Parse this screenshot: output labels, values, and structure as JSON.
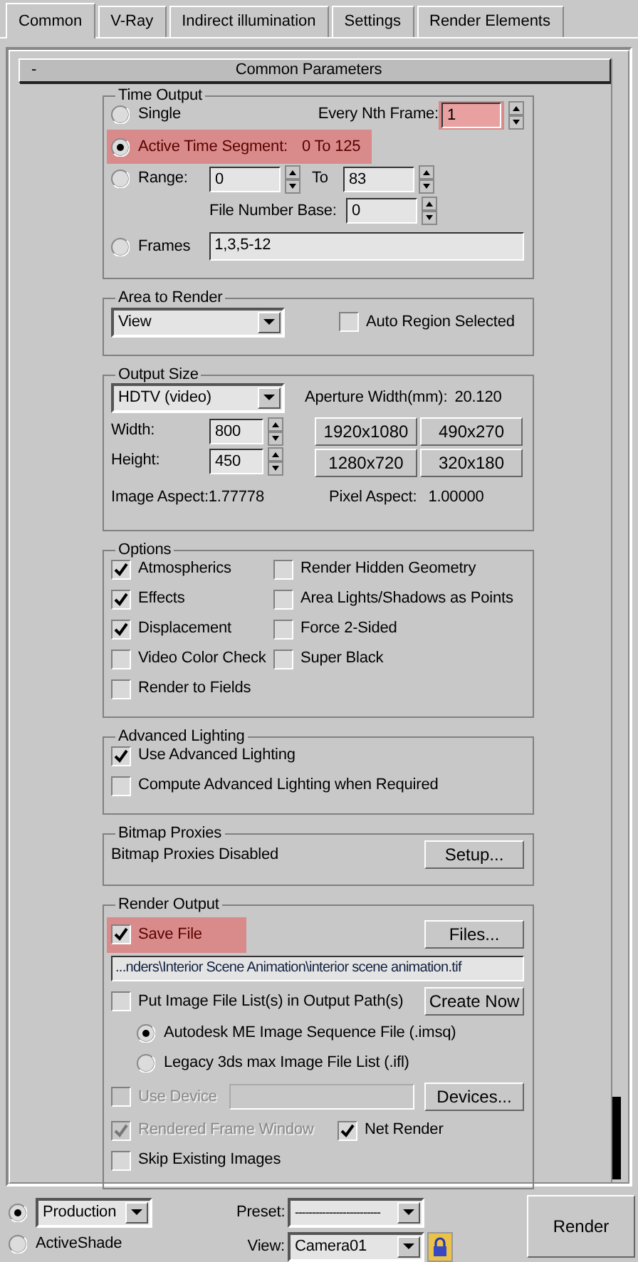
{
  "tabs": [
    {
      "label": "Common",
      "selected": true
    },
    {
      "label": "V-Ray",
      "selected": false
    },
    {
      "label": "Indirect illumination",
      "selected": false
    },
    {
      "label": "Settings",
      "selected": false
    },
    {
      "label": "Render Elements",
      "selected": false
    }
  ],
  "rollout": {
    "toggle": "-",
    "title": "Common Parameters"
  },
  "time_output": {
    "title": "Time Output",
    "single": {
      "label": "Single",
      "selected": false
    },
    "every_nth": {
      "label": "Every Nth Frame:",
      "value": "1",
      "highlighted": true
    },
    "active_segment": {
      "label": "Active Time Segment:",
      "range_text": "0 To 125",
      "selected": true,
      "highlighted": true
    },
    "range": {
      "label": "Range:",
      "selected": false,
      "from": "0",
      "to_label": "To",
      "to": "83"
    },
    "file_number_base": {
      "label": "File Number Base:",
      "value": "0"
    },
    "frames": {
      "label": "Frames",
      "selected": false,
      "value": "1,3,5-12"
    }
  },
  "area_to_render": {
    "title": "Area to Render",
    "dropdown": "View",
    "auto_region": {
      "label": "Auto Region Selected",
      "checked": false
    }
  },
  "output_size": {
    "title": "Output Size",
    "preset": "HDTV (video)",
    "aperture_label": "Aperture Width(mm):",
    "aperture_value": "20.120",
    "width": {
      "label": "Width:",
      "value": "800"
    },
    "height": {
      "label": "Height:",
      "value": "450"
    },
    "preset_buttons": [
      "1920x1080",
      "490x270",
      "1280x720",
      "320x180"
    ],
    "image_aspect": "Image Aspect:1.77778",
    "pixel_aspect_label": "Pixel Aspect:",
    "pixel_aspect_value": "1.00000"
  },
  "options": {
    "title": "Options",
    "columns": [
      [
        {
          "label": "Atmospherics",
          "checked": true
        },
        {
          "label": "Effects",
          "checked": true
        },
        {
          "label": "Displacement",
          "checked": true
        },
        {
          "label": "Video Color Check",
          "checked": false
        },
        {
          "label": "Render to Fields",
          "checked": false
        }
      ],
      [
        {
          "label": "Render Hidden Geometry",
          "checked": false
        },
        {
          "label": "Area Lights/Shadows as Points",
          "checked": false
        },
        {
          "label": "Force 2-Sided",
          "checked": false
        },
        {
          "label": "Super Black",
          "checked": false
        }
      ]
    ]
  },
  "advanced_lighting": {
    "title": "Advanced Lighting",
    "items": [
      {
        "label": "Use Advanced Lighting",
        "checked": true
      },
      {
        "label": "Compute Advanced Lighting when Required",
        "checked": false
      }
    ]
  },
  "bitmap_proxies": {
    "title": "Bitmap Proxies",
    "status": "Bitmap Proxies Disabled",
    "button": "Setup..."
  },
  "render_output": {
    "title": "Render Output",
    "save_file": {
      "label": "Save File",
      "checked": true,
      "highlighted": true
    },
    "files_button": "Files...",
    "path": "...nders\\Interior Scene Animation\\interior scene animation.tif",
    "put_list": {
      "label": "Put Image File List(s) in Output Path(s)",
      "checked": false
    },
    "create_button": "Create Now",
    "list_formats": [
      {
        "label": "Autodesk ME Image Sequence File (.imsq)",
        "selected": true
      },
      {
        "label": "Legacy 3ds max Image File List (.ifl)",
        "selected": false
      }
    ],
    "use_device": {
      "label": "Use Device",
      "checked": false,
      "disabled": true
    },
    "devices_button": "Devices...",
    "rendered_frame_window": {
      "label": "Rendered Frame Window",
      "checked": true,
      "disabled": true
    },
    "net_render": {
      "label": "Net Render",
      "checked": true,
      "disabled": false
    },
    "skip_existing": {
      "label": "Skip Existing Images",
      "checked": false,
      "disabled": false
    }
  },
  "bottom": {
    "modes": [
      {
        "label": "ActiveShade",
        "selected": false
      }
    ],
    "production": {
      "value": "Production",
      "selected": true
    },
    "preset": {
      "label": "Preset:",
      "value": "-------------------------"
    },
    "view": {
      "label": "View:",
      "value": "Camera01"
    },
    "render_button": "Render"
  }
}
